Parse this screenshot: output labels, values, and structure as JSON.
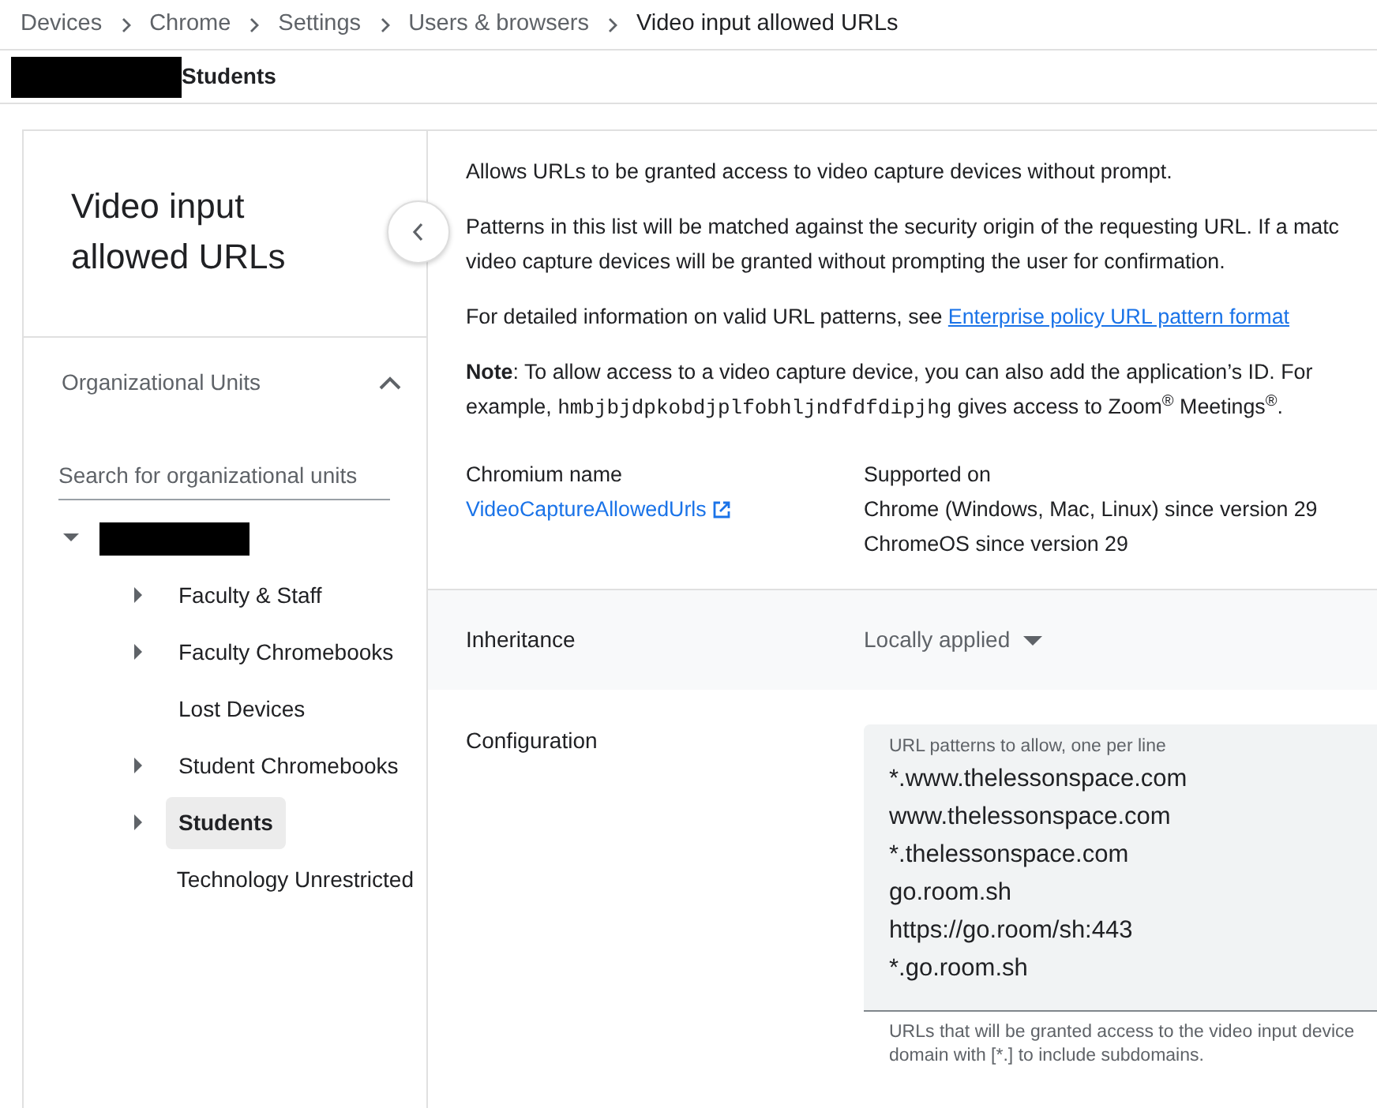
{
  "breadcrumbs": [
    {
      "label": "Devices",
      "current": false
    },
    {
      "label": "Chrome",
      "current": false
    },
    {
      "label": "Settings",
      "current": false
    },
    {
      "label": "Users & browsers",
      "current": false
    },
    {
      "label": "Video input allowed URLs",
      "current": true
    }
  ],
  "org_header": {
    "name": "Students"
  },
  "sidebar": {
    "title_lines": [
      "Video input",
      "allowed URLs"
    ],
    "section_title": "Organizational Units",
    "expanded": true,
    "search": {
      "placeholder": "Search for organizational units"
    },
    "tree": [
      {
        "expanded": true,
        "children": [
          {
            "label": "Faculty & Staff",
            "has_children": true,
            "selected": false
          },
          {
            "label": "Faculty Chromebooks",
            "has_children": true,
            "selected": false
          },
          {
            "label": "Lost Devices",
            "has_children": false,
            "selected": false
          },
          {
            "label": "Student Chromebooks",
            "has_children": true,
            "selected": false
          },
          {
            "label": "Students",
            "has_children": true,
            "selected": true
          },
          {
            "label": "Technology Unrestricted",
            "has_children": false,
            "selected": false
          }
        ]
      }
    ]
  },
  "policy": {
    "paragraphs": [
      [
        "Allows URLs to be granted access to video capture devices without prompt."
      ],
      [
        "Patterns in this list will be matched against the security origin of the requesting URL. If a matc",
        "video capture devices will be granted without prompting the user for confirmation."
      ]
    ],
    "link_paragraph": {
      "text": "For detailed information on valid URL patterns, see",
      "link": "Enterprise policy URL pattern format"
    },
    "note": {
      "before": [
        "**Note**: To allow access to a video capture device, you can also add the application’s ID. For",
        "example, "
      ],
      "code": "hmbjbjdpkobdjplfobhljndfdfdipjhg",
      "after": " gives access to Zoom$^{®}$ Meetings$^{®}$."
    },
    "chromium_name": {
      "label": "Chromium name",
      "value": "VideoCaptureAllowedUrls"
    },
    "supported_on": {
      "label": "Supported on",
      "lines": [
        "Chrome (Windows, Mac, Linux) since version 29",
        "ChromeOS since version 29"
      ]
    },
    "inheritance": {
      "label": "Inheritance",
      "value": "Locally applied"
    },
    "configuration": {
      "label": "Configuration",
      "field_label": "URL patterns to allow, one per line",
      "lines": [
        "*.www.thelessonspace.com",
        "www.thelessonspace.com",
        "*.thelessonspace.com",
        "go.room.sh",
        "https://go.room/sh:443",
        "*.go.room.sh"
      ],
      "helper_lines": [
        "URLs that will be granted access to the video input device",
        "domain with [*.] to include subdomains."
      ]
    }
  }
}
